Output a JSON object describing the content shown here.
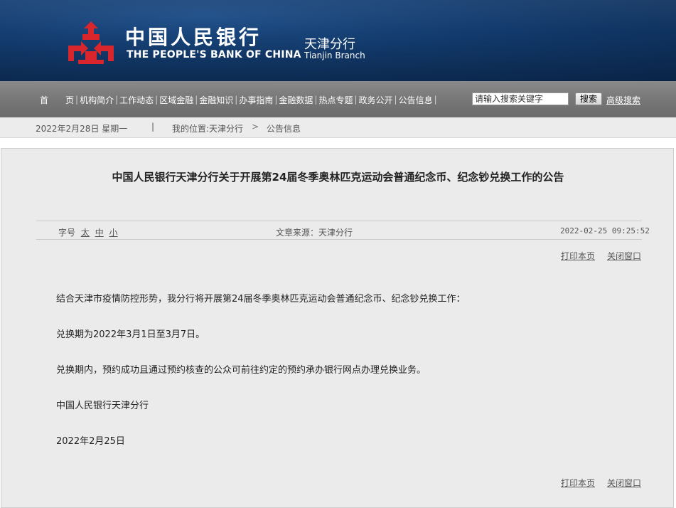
{
  "header": {
    "bank_name_cn": "中国人民银行",
    "bank_name_en": "THE PEOPLE'S BANK OF CHINA",
    "branch_cn": "天津分行",
    "branch_en": "Tianjin  Branch",
    "logo_icon": "pboc-logo-icon",
    "colors": {
      "banner": "#123a6c",
      "logo_red": "#d8262c"
    }
  },
  "nav": {
    "items": [
      "首　　页",
      "机构简介",
      "工作动态",
      "区域金融",
      "金融知识",
      "办事指南",
      "金融数据",
      "热点专题",
      "政务公开",
      "公告信息"
    ],
    "search_placeholder": "请输入搜索关键字",
    "search_button": "搜索",
    "advanced_search": "高级搜索"
  },
  "breadcrumb": {
    "date": "2022年2月28日  星期一",
    "separator": "|",
    "location": "我的位置:天津分行",
    "arrow": ">",
    "current": "公告信息"
  },
  "article": {
    "title": "中国人民银行天津分行关于开展第24届冬季奥林匹克运动会普通纪念币、纪念钞兑换工作的公告",
    "font_size_label": "字号",
    "font_sizes": [
      "太",
      "中",
      "小"
    ],
    "source": "文章来源：天津分行",
    "publish_time": "2022-02-25  09:25:52",
    "print_label": "打印本页",
    "close_label": "关闭窗口",
    "paragraphs": [
      "结合天津市疫情防控形势，我分行将开展第24届冬季奥林匹克运动会普通纪念币、纪念钞兑换工作：",
      "兑换期为2022年3月1日至3月7日。",
      "兑换期内，预约成功且通过预约核查的公众可前往约定的预约承办银行网点办理兑换业务。",
      "中国人民银行天津分行",
      "2022年2月25日"
    ]
  }
}
